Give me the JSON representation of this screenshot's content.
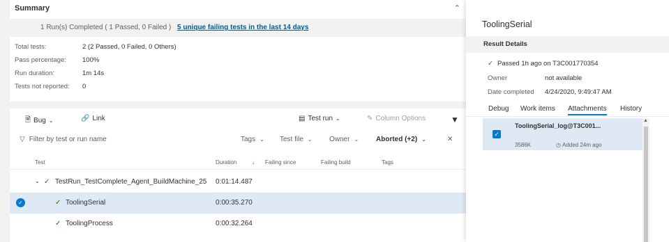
{
  "summary": {
    "title": "Summary",
    "run_text": "1 Run(s) Completed ( 1 Passed, 0 Failed )",
    "run_link": "5 unique failing tests in the last 14 days",
    "stats": [
      {
        "label": "Total tests:",
        "value": "2 (2 Passed, 0 Failed, 0 Others)"
      },
      {
        "label": "Pass percentage:",
        "value": "100%"
      },
      {
        "label": "Run duration:",
        "value": "1m 14s"
      },
      {
        "label": "Tests not reported:",
        "value": "0"
      }
    ]
  },
  "toolbar": {
    "bug_label": "Bug",
    "link_label": "Link",
    "test_run_label": "Test run",
    "column_options_label": "Column Options"
  },
  "filter": {
    "placeholder": "Filter by test or run name",
    "tags": "Tags",
    "test_file": "Test file",
    "owner": "Owner",
    "outcome": "Aborted (+2)"
  },
  "columns": {
    "test": "Test",
    "duration": "Duration",
    "failing_since": "Failing since",
    "failing_build": "Failing build",
    "tags": "Tags"
  },
  "rows": [
    {
      "name": "TestRun_TestComplete_Agent_BuildMachine_25",
      "duration": "0:01:14.487"
    },
    {
      "name": "ToolingSerial",
      "duration": "0:00:35.270"
    },
    {
      "name": "ToolingProcess",
      "duration": "0:00:32.264"
    }
  ],
  "details": {
    "title": "ToolingSerial",
    "section": "Result Details",
    "status": "Passed 1h ago on T3C001770354",
    "owner_label": "Owner",
    "owner_value": "not available",
    "date_label": "Date completed",
    "date_value": "4/24/2020, 9:49:47 AM",
    "tabs": [
      "Debug",
      "Work items",
      "Attachments",
      "History"
    ],
    "attachment": {
      "name": "ToolingSerial_log@T3C001...",
      "size": "3586K",
      "added": "Added 24m ago"
    }
  },
  "colors": {
    "accent": "#0078d4",
    "selected_row": "#dfe9f5",
    "pass_check": "#107c10"
  }
}
